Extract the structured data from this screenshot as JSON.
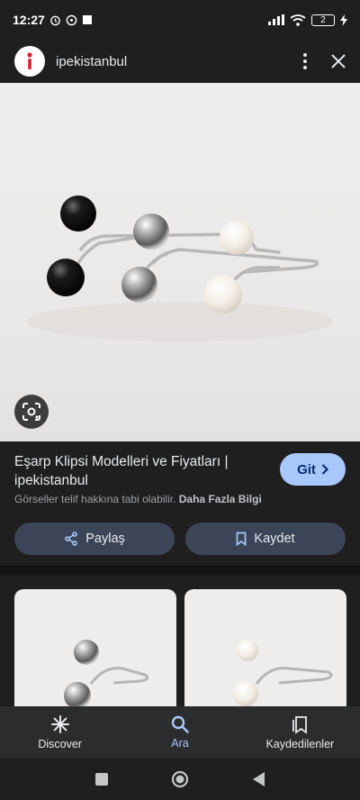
{
  "status": {
    "time": "12:27",
    "battery": "2"
  },
  "header": {
    "site_name": "ipekistanbul"
  },
  "result": {
    "title": "Eşarp Klipsi Modelleri ve Fiyatları | ipekistanbul",
    "go_label": "Git",
    "copyright_text": "Görseller telif hakkına tabi olabilir.",
    "more_info_label": "Daha Fazla Bilgi",
    "share_label": "Paylaş",
    "save_label": "Kaydet"
  },
  "bottom_nav": [
    {
      "label": "Discover",
      "icon": "asterisk-icon"
    },
    {
      "label": "Ara",
      "icon": "search-icon"
    },
    {
      "label": "Kaydedilenler",
      "icon": "saved-collections-icon"
    }
  ],
  "colors": {
    "accent": "#a8c7fa",
    "button": "#3c4558",
    "background": "#1f1f1f"
  }
}
